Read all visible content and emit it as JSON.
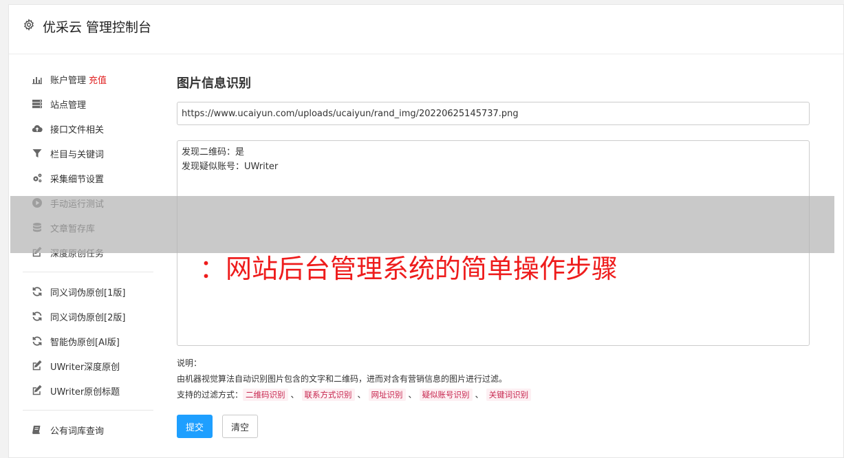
{
  "header": {
    "title": "优采云 管理控制台",
    "icon": "gear-icon"
  },
  "sidebar": {
    "groups": [
      [
        {
          "label": "账户管理",
          "extra": "充值",
          "icon": "bar-chart-icon"
        },
        {
          "label": "站点管理",
          "icon": "server-icon"
        },
        {
          "label": "接口文件相关",
          "icon": "cloud-upload-icon"
        },
        {
          "label": "栏目与关键词",
          "icon": "filter-icon"
        },
        {
          "label": "采集细节设置",
          "icon": "gears-icon"
        },
        {
          "label": "手动运行测试",
          "icon": "play-circle-icon"
        },
        {
          "label": "文章暂存库",
          "icon": "database-icon"
        },
        {
          "label": "深度原创任务",
          "icon": "edit-icon"
        }
      ],
      [
        {
          "label": "同义词伪原创[1版]",
          "icon": "refresh-icon"
        },
        {
          "label": "同义词伪原创[2版]",
          "icon": "refresh-icon"
        },
        {
          "label": "智能伪原创[AI版]",
          "icon": "refresh-icon"
        },
        {
          "label": "UWriter深度原创",
          "icon": "edit-icon"
        },
        {
          "label": "UWriter原创标题",
          "icon": "edit-icon"
        }
      ],
      [
        {
          "label": "公有词库查询",
          "icon": "book-icon"
        }
      ]
    ]
  },
  "main": {
    "title": "图片信息识别",
    "url_value": "https://www.ucaiyun.com/uploads/ucaiyun/rand_img/20220625145737.png",
    "result_lines": [
      "发现二维码：是",
      "发现疑似账号：UWriter"
    ],
    "desc_label": "说明：",
    "desc_text": "由机器视觉算法自动识别图片包含的文字和二维码，进而对含有营销信息的图片进行过滤。",
    "support_label": "支持的过滤方式：",
    "tags": [
      "二维码识别",
      "联系方式识别",
      "网址识别",
      "疑似账号识别",
      "关键词识别"
    ],
    "tag_separator": "、",
    "submit_label": "提交",
    "clear_label": "清空"
  },
  "watermark": "：网站后台管理系统的简单操作步骤",
  "colors": {
    "accent": "#1e9fff",
    "extra": "#e02020",
    "tag": "#c7254e",
    "watermark": "#ee1c1c"
  }
}
